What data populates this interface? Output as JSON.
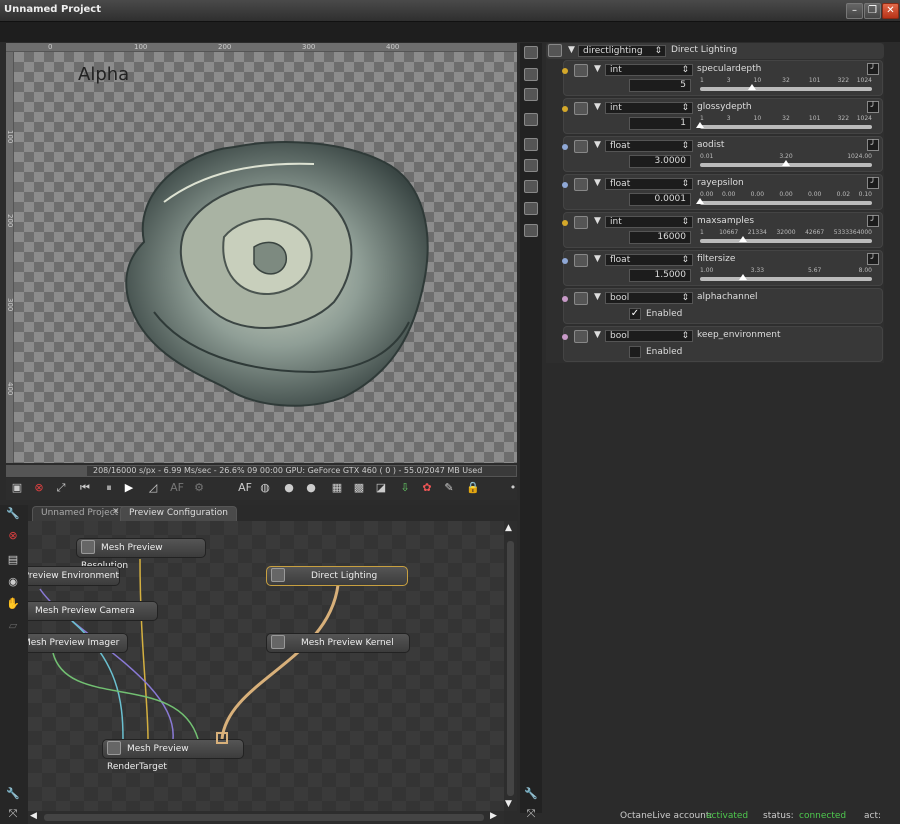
{
  "window": {
    "title": "Unnamed Project"
  },
  "viewport": {
    "overlay_label": "Alpha",
    "ruler_top": [
      "0",
      "100",
      "200",
      "300",
      "400"
    ],
    "ruler_left": [
      "100",
      "200",
      "300",
      "400"
    ],
    "status": "208/16000 s/px - 6.99 Ms/sec - 26.6% 09 00:00 GPU: GeForce GTX 460 ( 0 ) - 55.0/2047 MB Used"
  },
  "tabs": [
    {
      "label": "Unnamed Project"
    },
    {
      "label": "Preview Configuration"
    }
  ],
  "graph": {
    "nodes": [
      {
        "label": "Mesh Preview Resolution"
      },
      {
        "label": "Mesh Preview Environment"
      },
      {
        "label": "Mesh Preview Camera"
      },
      {
        "label": "Mesh Preview Imager"
      },
      {
        "label": "Direct Lighting"
      },
      {
        "label": "Mesh Preview Kernel"
      },
      {
        "label": "Mesh Preview RenderTarget"
      }
    ]
  },
  "props": {
    "header_select": "directlighting",
    "header_title": "Direct Lighting",
    "rows": [
      {
        "type": "int",
        "name": "speculardepth",
        "value": "5",
        "ticks": [
          "1",
          "3",
          "10",
          "32",
          "101",
          "322",
          "1024"
        ],
        "pos": 0.3,
        "dot": "#d4a82a"
      },
      {
        "type": "int",
        "name": "glossydepth",
        "value": "1",
        "ticks": [
          "1",
          "3",
          "10",
          "32",
          "101",
          "322",
          "1024"
        ],
        "pos": 0.0,
        "dot": "#d4a82a"
      },
      {
        "type": "float",
        "name": "aodist",
        "value": "3.0000",
        "ticks": [
          "0.01",
          "3.20",
          "1024.00"
        ],
        "pos": 0.5,
        "dot": "#8fa8d6"
      },
      {
        "type": "float",
        "name": "rayepsilon",
        "value": "0.0001",
        "ticks": [
          "0.00",
          "0.00",
          "0.00",
          "0.00",
          "0.00",
          "0.02",
          "0.10"
        ],
        "pos": 0.0,
        "dot": "#8fa8d6"
      },
      {
        "type": "int",
        "name": "maxsamples",
        "value": "16000",
        "ticks": [
          "1",
          "10667",
          "21334",
          "32000",
          "42667",
          "53333",
          "64000"
        ],
        "pos": 0.25,
        "dot": "#d4a82a"
      },
      {
        "type": "float",
        "name": "filtersize",
        "value": "1.5000",
        "ticks": [
          "1.00",
          "3.33",
          "5.67",
          "8.00"
        ],
        "pos": 0.25,
        "dot": "#8fa8d6"
      }
    ],
    "bools": [
      {
        "type": "bool",
        "name": "alphachannel",
        "label": "Enabled",
        "checked": true,
        "mark": "✓",
        "dot": "#c89ac8"
      },
      {
        "type": "bool",
        "name": "keep_environment",
        "label": "Enabled",
        "checked": false,
        "mark": "",
        "dot": "#c89ac8"
      }
    ]
  },
  "footer": {
    "account_label": "OctaneLive account:",
    "account_value": "activated",
    "status_label": "status:",
    "status_value": "connected",
    "act_label": "act:",
    "accent": "#4ec94e"
  }
}
